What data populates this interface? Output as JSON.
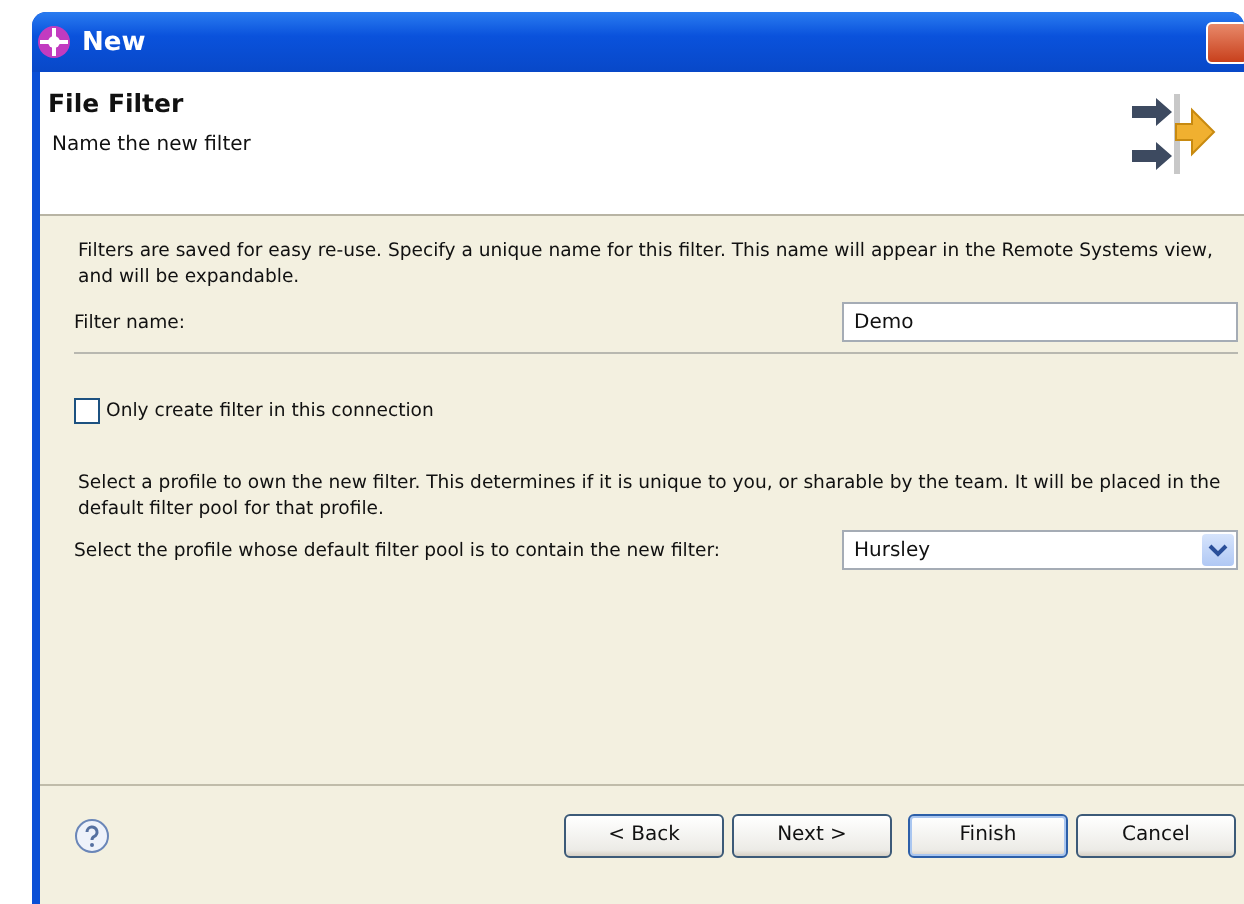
{
  "window": {
    "title": "New"
  },
  "header": {
    "title": "File Filter",
    "subtitle": "Name the new filter"
  },
  "description": "Filters are saved for easy re-use. Specify a unique name for this filter. This name will appear in the Remote Systems view, and will be expandable.",
  "filter_name": {
    "label": "Filter name:",
    "value": "Demo"
  },
  "only_connection": {
    "label": "Only create filter in this connection",
    "checked": false
  },
  "profile_description": "Select a profile to own the new filter. This determines if it is unique to you, or sharable by the team. It will be placed in the default filter pool for that profile.",
  "profile": {
    "label": "Select the profile whose default filter pool is to contain the new filter:",
    "value": "Hursley"
  },
  "buttons": [
    {
      "label": "< Back",
      "default": false
    },
    {
      "label": "Next >",
      "default": false
    },
    {
      "label": "Finish",
      "default": true
    },
    {
      "label": "Cancel",
      "default": false
    }
  ]
}
